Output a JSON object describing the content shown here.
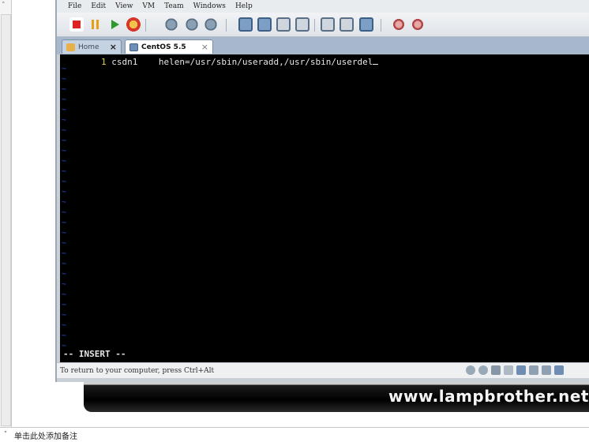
{
  "menu": [
    "File",
    "Edit",
    "View",
    "VM",
    "Team",
    "Windows",
    "Help"
  ],
  "toolbar": {
    "icons": [
      "stop-icon",
      "pause-icon",
      "play-icon",
      "reset-icon",
      "snapshot-icon",
      "revert-snapshot-icon",
      "snapshot-manager-icon",
      "full-screen-icon",
      "quick-switch-icon",
      "summary-icon",
      "console-view-icon",
      "appliance-view-icon",
      "settings-icon",
      "tools-icon"
    ]
  },
  "tabs": [
    {
      "label": "Home",
      "active": false
    },
    {
      "label": "CentOS 5.5",
      "active": true
    }
  ],
  "console": {
    "line_number": "1",
    "line_text": "csdn1    helen=/usr/sbin/useradd,/usr/sbin/userdel",
    "mode": "-- INSERT --",
    "tilde": "~"
  },
  "statusbar": {
    "message": "To return to your computer, press Ctrl+Alt"
  },
  "watermark": "www.lampbrother.net",
  "bottom_note": "单击此处添加备注",
  "colors": {
    "console_bg": "#000000",
    "tilde": "#2b4fd1",
    "line_number": "#e5d34a",
    "tabbar": "#a7b8cc"
  }
}
